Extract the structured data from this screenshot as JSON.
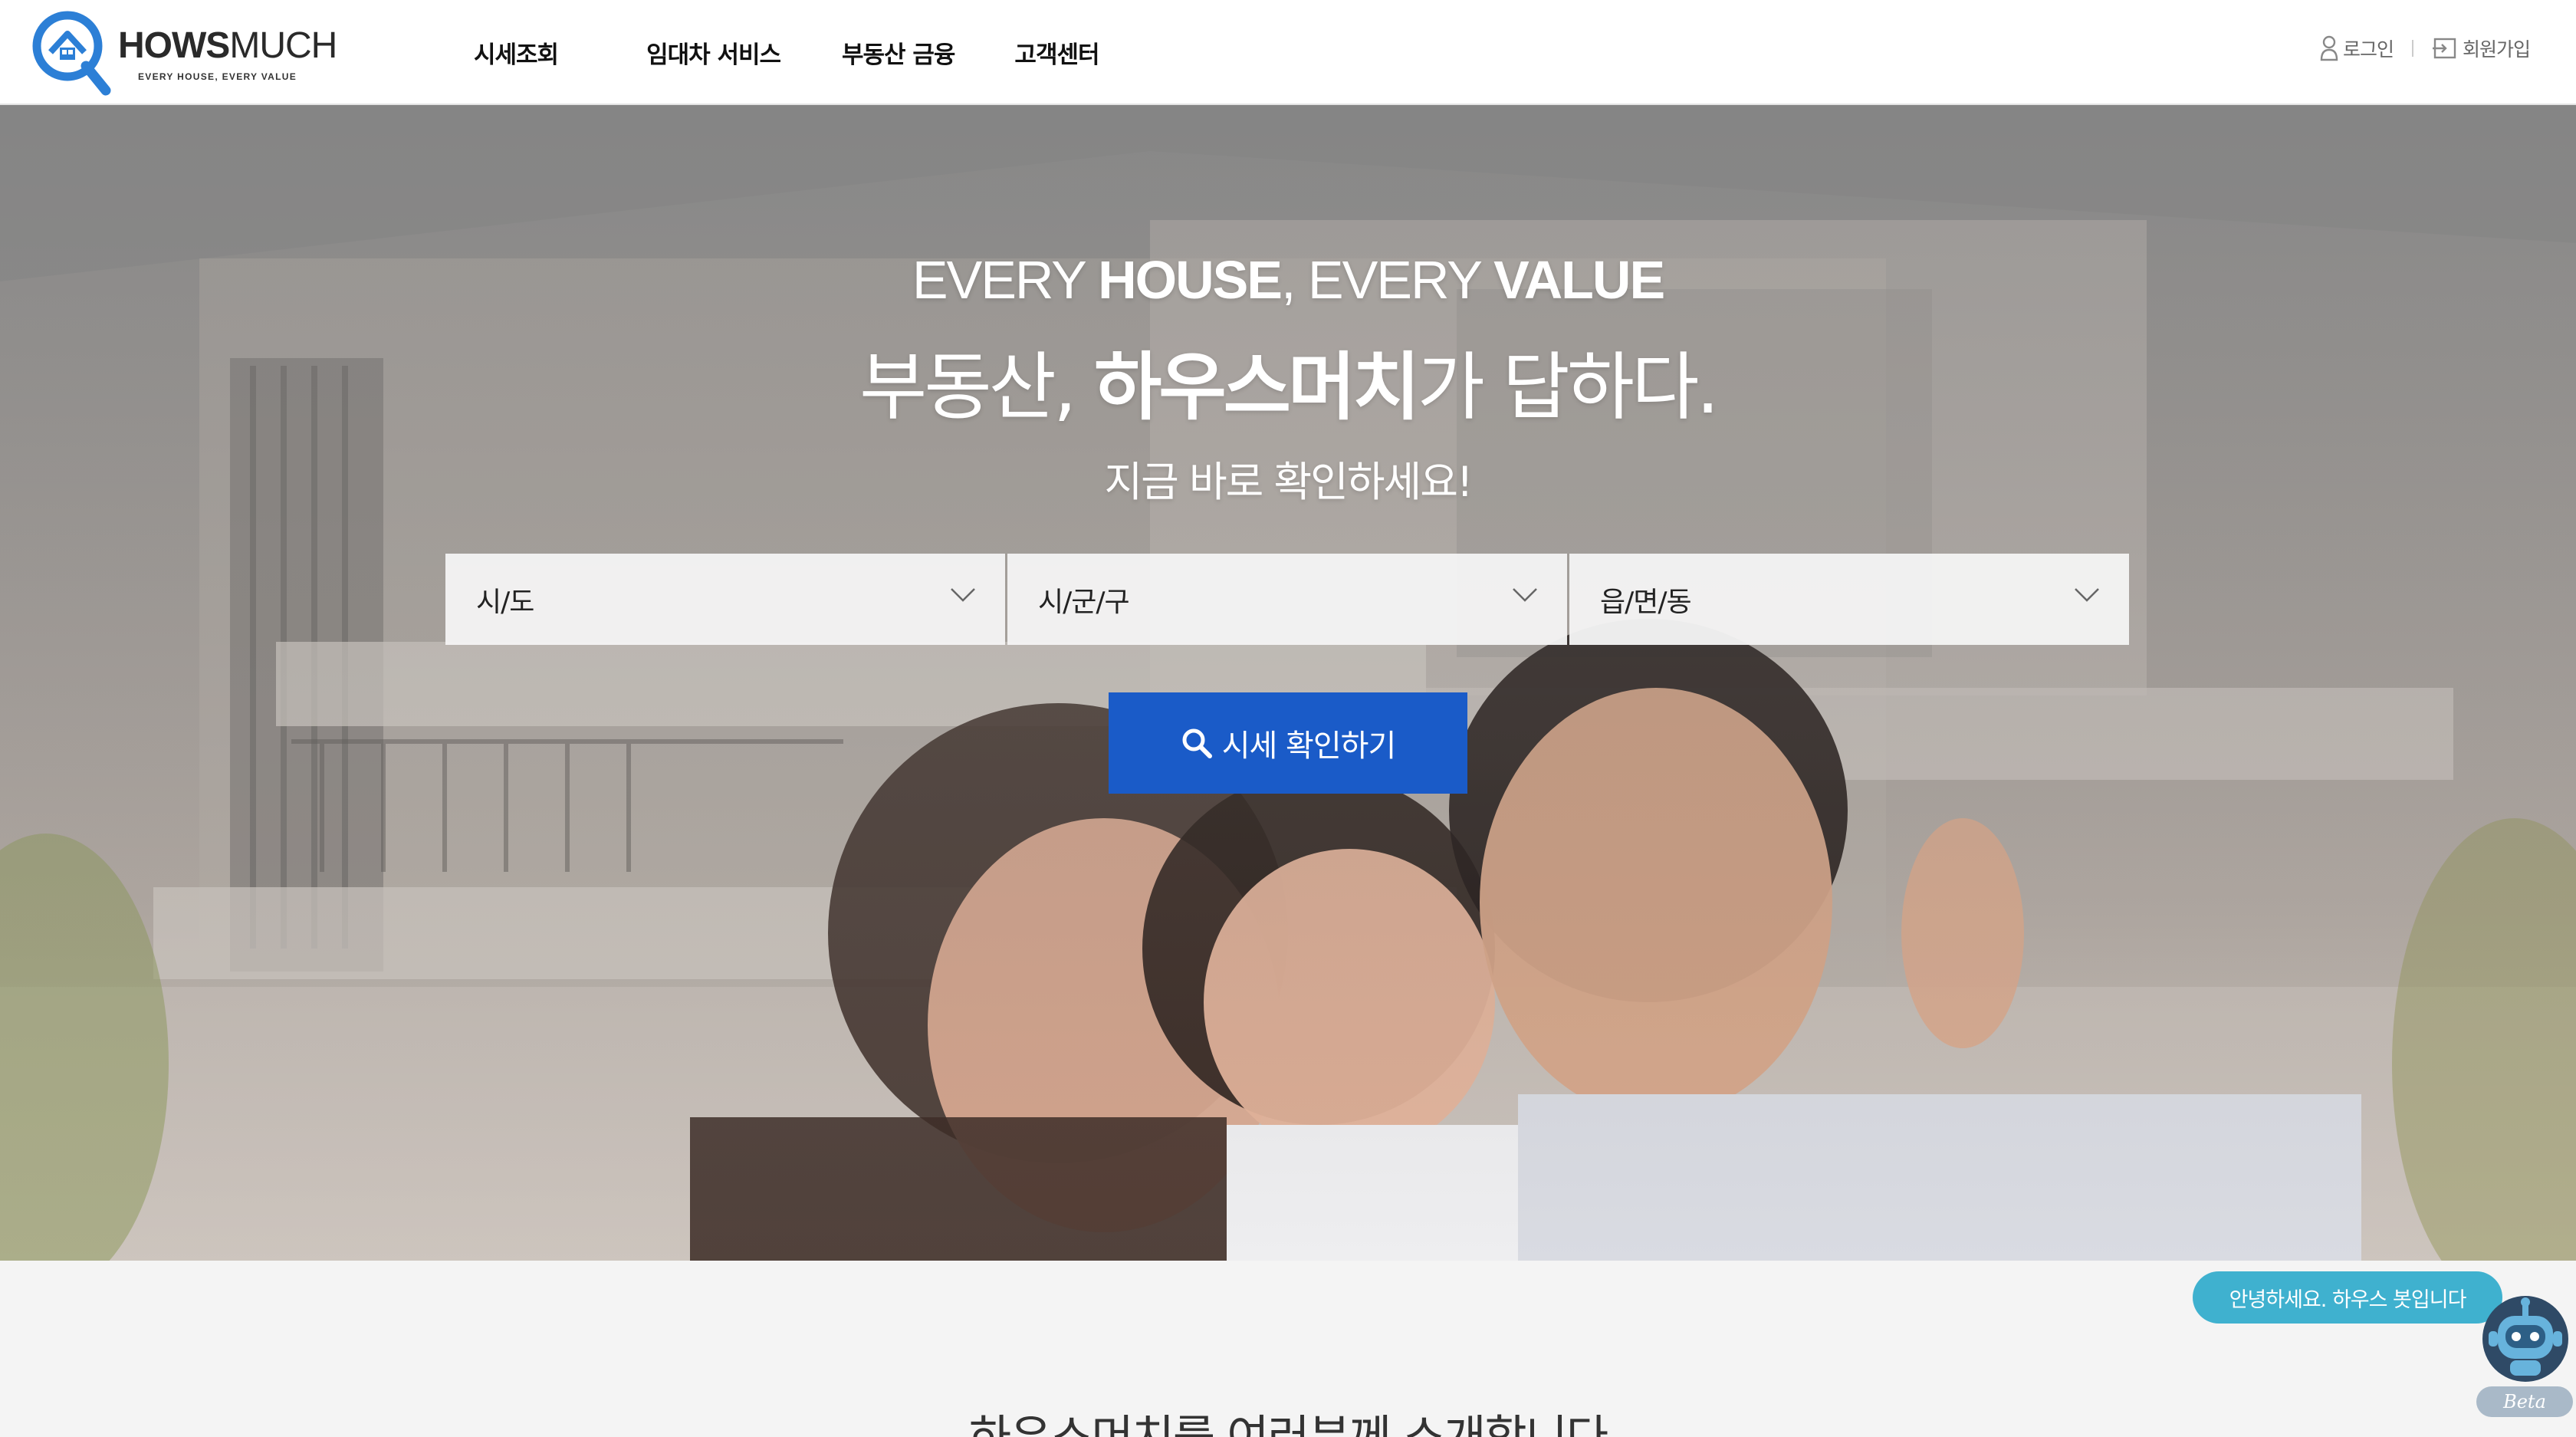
{
  "brand": {
    "name_bold": "HOWS",
    "name_light": "MUCH",
    "tagline": "EVERY HOUSE, EVERY VALUE"
  },
  "nav": {
    "items": [
      {
        "label": "시세조회"
      },
      {
        "label": "임대차 서비스"
      },
      {
        "label": "부동산 금융"
      },
      {
        "label": "고객센터"
      }
    ]
  },
  "util": {
    "login": "로그인",
    "signup": "회원가입"
  },
  "hero": {
    "line1_a": "EVERY ",
    "line1_b": "HOUSE",
    "line1_c": ", EVERY ",
    "line1_d": "VALUE",
    "line2_a": "부동산, ",
    "line2_b": "하우스머치",
    "line2_c": "가 답하다.",
    "line3": "지금 바로 확인하세요!",
    "selects": [
      {
        "value": "시/도"
      },
      {
        "value": "시/군/구"
      },
      {
        "value": "읍/면/동"
      }
    ],
    "search_button": "시세 확인하기"
  },
  "intro_heading": "하우스머치를 여러분께 소개합니다",
  "chatbot": {
    "greeting": "안녕하세요. 하우스 봇입니다",
    "badge": "Beta"
  },
  "colors": {
    "accent": "#1a5bc8",
    "chat_bubble": "#3fb1cf",
    "logo_blue": "#2c7fd6"
  }
}
